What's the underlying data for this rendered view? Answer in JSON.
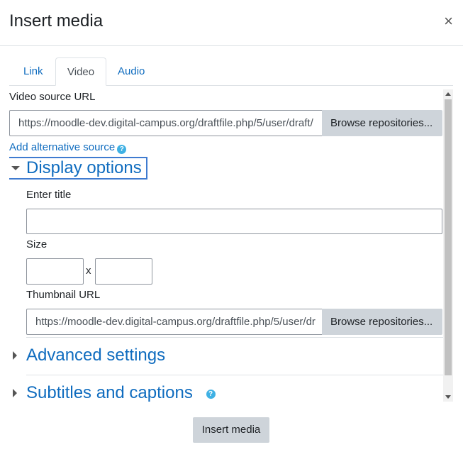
{
  "dialog": {
    "title": "Insert media",
    "close_glyph": "×"
  },
  "tabs": [
    {
      "label": "Link",
      "active": false
    },
    {
      "label": "Video",
      "active": true
    },
    {
      "label": "Audio",
      "active": false
    }
  ],
  "video": {
    "source_label": "Video source URL",
    "source_value": "https://moodle-dev.digital-campus.org/draftfile.php/5/user/draft/",
    "browse_label": "Browse repositories...",
    "add_alt_label": "Add alternative source",
    "help_glyph": "?"
  },
  "display_options": {
    "title": "Display options",
    "enter_title_label": "Enter title",
    "enter_title_value": "",
    "size_label": "Size",
    "width_value": "",
    "height_value": "",
    "size_separator": "x",
    "thumbnail_label": "Thumbnail URL",
    "thumbnail_value": "https://moodle-dev.digital-campus.org/draftfile.php/5/user/dr",
    "browse_label": "Browse repositories..."
  },
  "advanced": {
    "title": "Advanced settings"
  },
  "subtitles": {
    "title": "Subtitles and captions",
    "help_glyph": "?"
  },
  "footer": {
    "insert_label": "Insert media"
  },
  "colors": {
    "link": "#0f6cbf",
    "focus": "#3f7bd0",
    "button_bg": "#ced4da",
    "help": "#3fb1e4"
  }
}
